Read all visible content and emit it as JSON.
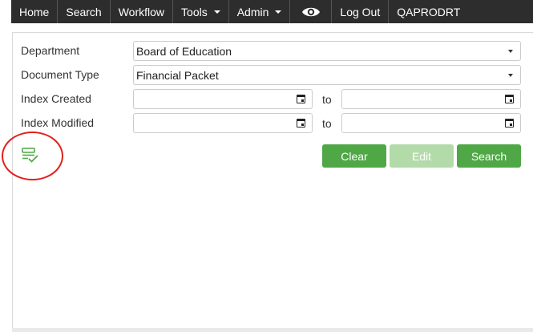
{
  "nav": {
    "home": "Home",
    "search": "Search",
    "workflow": "Workflow",
    "tools": "Tools",
    "admin": "Admin",
    "eye_icon": "eye-icon",
    "logout": "Log Out",
    "user": "QAPRODRT"
  },
  "form": {
    "department_label": "Department",
    "department_value": "Board of Education",
    "doctype_label": "Document Type",
    "doctype_value": "Financial Packet",
    "created_label": "Index Created",
    "modified_label": "Index Modified",
    "to_label": "to"
  },
  "buttons": {
    "clear": "Clear",
    "edit": "Edit",
    "search": "Search"
  },
  "icons": {
    "list_check": "list-check-icon",
    "calendar": "calendar-icon",
    "caret": "chevron-down-icon"
  },
  "colors": {
    "navbar": "#2d2d2d",
    "button_green": "#4fa845",
    "button_disabled": "#b3dba9",
    "highlight_circle": "#e0201c"
  }
}
